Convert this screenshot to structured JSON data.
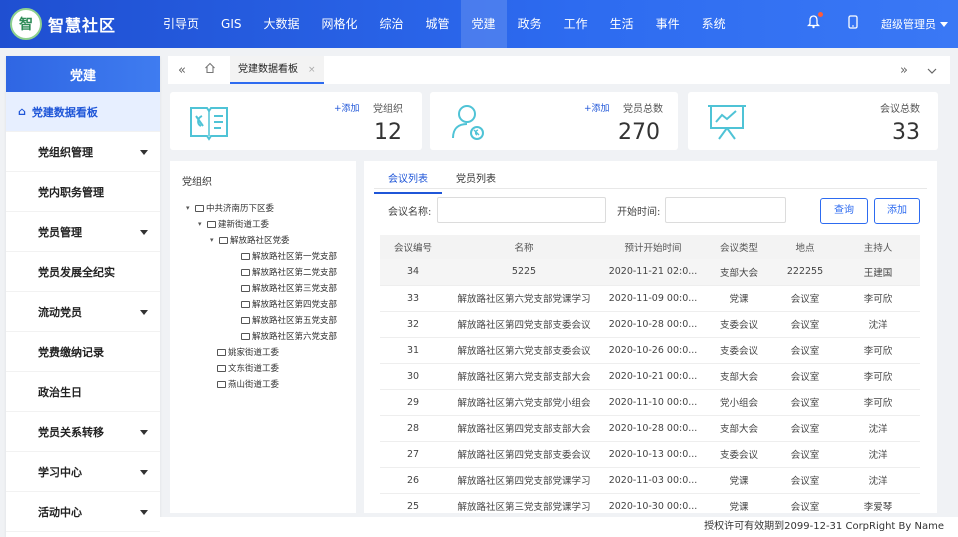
{
  "app": {
    "logo_mark": "智",
    "title": "智慧社区"
  },
  "nav": [
    {
      "label": "引导页"
    },
    {
      "label": "GIS"
    },
    {
      "label": "大数据"
    },
    {
      "label": "网格化"
    },
    {
      "label": "综治"
    },
    {
      "label": "城管"
    },
    {
      "label": "党建",
      "active": true
    },
    {
      "label": "政务"
    },
    {
      "label": "工作"
    },
    {
      "label": "生活"
    },
    {
      "label": "事件"
    },
    {
      "label": "系统"
    }
  ],
  "user": {
    "name": "超级管理员"
  },
  "sidebar": {
    "title": "党建",
    "items": [
      {
        "label": "党建数据看板",
        "active": true,
        "arrow": false
      },
      {
        "label": "党组织管理",
        "arrow": true
      },
      {
        "label": "党内职务管理",
        "arrow": false
      },
      {
        "label": "党员管理",
        "arrow": true
      },
      {
        "label": "党员发展全纪实",
        "arrow": false
      },
      {
        "label": "流动党员",
        "arrow": true
      },
      {
        "label": "党费缴纳记录",
        "arrow": false
      },
      {
        "label": "政治生日",
        "arrow": false
      },
      {
        "label": "党员关系转移",
        "arrow": true
      },
      {
        "label": "学习中心",
        "arrow": true
      },
      {
        "label": "活动中心",
        "arrow": true
      }
    ]
  },
  "tabs": {
    "active_label": "党建数据看板",
    "close": "×"
  },
  "stats": {
    "org": {
      "add": "+添加",
      "label": "党组织",
      "value": "12"
    },
    "member": {
      "add": "+添加",
      "label": "党员总数",
      "value": "270"
    },
    "meeting": {
      "label": "会议总数",
      "value": "33"
    }
  },
  "tree": {
    "title": "党组织",
    "nodes": [
      {
        "label": "中共济南历下区委",
        "toggle": "▾",
        "folder": true
      },
      {
        "label": "建新街道工委",
        "toggle": "▾",
        "folder": true
      },
      {
        "label": "解放路社区党委",
        "toggle": "▾",
        "folder": true
      },
      {
        "label": "解放路社区第一党支部",
        "toggle": "",
        "folder": true
      },
      {
        "label": "解放路社区第二党支部",
        "toggle": "",
        "folder": true
      },
      {
        "label": "解放路社区第三党支部",
        "toggle": "",
        "folder": true
      },
      {
        "label": "解放路社区第四党支部",
        "toggle": "",
        "folder": true
      },
      {
        "label": "解放路社区第五党支部",
        "toggle": "",
        "folder": true
      },
      {
        "label": "解放路社区第六党支部",
        "toggle": "",
        "folder": true
      },
      {
        "label": "姚家街道工委",
        "toggle": "",
        "folder": true
      },
      {
        "label": "文东街道工委",
        "toggle": "",
        "folder": true
      },
      {
        "label": "燕山街道工委",
        "toggle": "",
        "folder": true
      }
    ]
  },
  "list": {
    "tabs": [
      "会议列表",
      "党员列表"
    ],
    "filter": {
      "name_label": "会议名称:",
      "name_value": "",
      "time_label": "开始时间:",
      "time_value": ""
    },
    "buttons": {
      "query": "查询",
      "add": "添加"
    },
    "columns": [
      "会议编号",
      "名称",
      "预计开始时间",
      "会议类型",
      "地点",
      "主持人"
    ],
    "rows": [
      [
        "34",
        "5225",
        "2020-11-21 02:0...",
        "支部大会",
        "222255",
        "王建国"
      ],
      [
        "33",
        "解放路社区第六党支部党课学习",
        "2020-11-09 00:0...",
        "党课",
        "会议室",
        "李可欣"
      ],
      [
        "32",
        "解放路社区第四党支部支委会议",
        "2020-10-28 00:0...",
        "支委会议",
        "会议室",
        "沈洋"
      ],
      [
        "31",
        "解放路社区第六党支部支委会议",
        "2020-10-26 00:0...",
        "支委会议",
        "会议室",
        "李可欣"
      ],
      [
        "30",
        "解放路社区第六党支部支部大会",
        "2020-10-21 00:0...",
        "支部大会",
        "会议室",
        "李可欣"
      ],
      [
        "29",
        "解放路社区第六党支部党小组会",
        "2020-11-10 00:0...",
        "党小组会",
        "会议室",
        "李可欣"
      ],
      [
        "28",
        "解放路社区第四党支部支部大会",
        "2020-10-28 00:0...",
        "支部大会",
        "会议室",
        "沈洋"
      ],
      [
        "27",
        "解放路社区第四党支部支委会议",
        "2020-10-13 00:0...",
        "支委会议",
        "会议室",
        "沈洋"
      ],
      [
        "26",
        "解放路社区第四党支部党课学习",
        "2020-11-03 00:0...",
        "党课",
        "会议室",
        "沈洋"
      ],
      [
        "25",
        "解放路社区第三党支部党课学习",
        "2020-10-30 00:0...",
        "党课",
        "会议室",
        "李爱琴"
      ]
    ]
  },
  "footer": {
    "text": "授权许可有效期到2099-12-31 CorpRight By Name"
  },
  "colors": {
    "primary": "#2d6bf0",
    "accent_icon": "#4fc3d6",
    "notify_dot": "#ff5b3a"
  }
}
